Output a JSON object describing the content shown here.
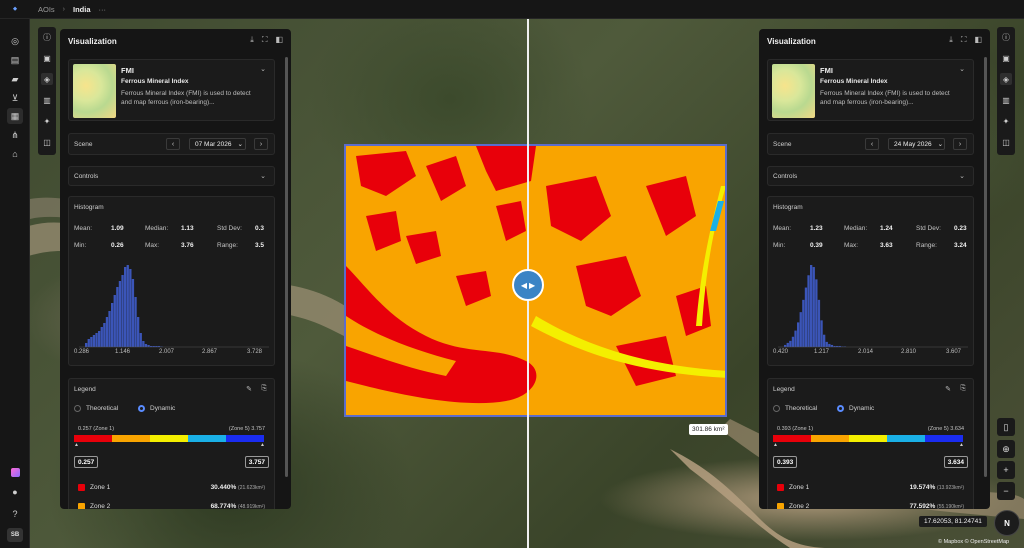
{
  "breadcrumb": {
    "root": "AOIs",
    "current": "India",
    "more": "···"
  },
  "user": {
    "initials": "SB"
  },
  "left_nav": [
    "explore-icon",
    "catalog-icon",
    "truck-icon",
    "cart-icon",
    "map-icon",
    "workflow-icon",
    "warehouse-icon"
  ],
  "map": {
    "area_label": "301.86 km²",
    "coords": "17.62053, 81.24741",
    "compass": "N",
    "attribution": "© Mapbox © OpenStreetMap",
    "zoom_in": "+",
    "zoom_out": "−"
  },
  "panels": {
    "left": {
      "title": "Visualization",
      "index_name": "FMI",
      "index_full": "Ferrous Mineral Index",
      "index_desc": "Ferrous Mineral Index (FMI) is used to detect and map ferrous (iron-bearing)...",
      "scene_label": "Scene",
      "scene_date": "07 Mar 2026",
      "controls_label": "Controls",
      "histogram_label": "Histogram",
      "stats": {
        "mean_label": "Mean:",
        "mean": "1.09",
        "median_label": "Median:",
        "median": "1.13",
        "std_label": "Std Dev:",
        "std": "0.3",
        "min_label": "Min:",
        "min": "0.26",
        "max_label": "Max:",
        "max": "3.76",
        "range_label": "Range:",
        "range": "3.5"
      },
      "hist_ticks": [
        "0.286",
        "1.146",
        "2.007",
        "2.867",
        "3.728"
      ],
      "hist_values": [
        4,
        8,
        10,
        12,
        14,
        16,
        20,
        24,
        30,
        36,
        44,
        52,
        60,
        66,
        72,
        80,
        82,
        78,
        68,
        50,
        30,
        14,
        6,
        3,
        2,
        1,
        1,
        1,
        1,
        0.5
      ],
      "legend_label": "Legend",
      "mode_theoretical": "Theoretical",
      "mode_dynamic": "Dynamic",
      "zone_min_label": "0.257 (Zone 1)",
      "zone_max_label": "(Zone 5) 3.757",
      "min_value": "0.257",
      "max_value": "3.757",
      "zones": [
        {
          "name": "Zone 1",
          "pct": "30.440%",
          "area": "(21.623km²)",
          "color": "#e8000a"
        },
        {
          "name": "Zone 2",
          "pct": "68.774%",
          "area": "(48.919km²)",
          "color": "#f9a400"
        }
      ]
    },
    "right": {
      "title": "Visualization",
      "index_name": "FMI",
      "index_full": "Ferrous Mineral Index",
      "index_desc": "Ferrous Mineral Index (FMI) is used to detect and map ferrous (iron-bearing)...",
      "scene_label": "Scene",
      "scene_date": "24 May 2026",
      "controls_label": "Controls",
      "histogram_label": "Histogram",
      "stats": {
        "mean_label": "Mean:",
        "mean": "1.23",
        "median_label": "Median:",
        "median": "1.24",
        "std_label": "Std Dev:",
        "std": "0.23",
        "min_label": "Min:",
        "min": "0.39",
        "max_label": "Max:",
        "max": "3.63",
        "range_label": "Range:",
        "range": "3.24"
      },
      "hist_ticks": [
        "0.420",
        "1.217",
        "2.014",
        "2.810",
        "3.607"
      ],
      "hist_values": [
        2,
        4,
        6,
        10,
        16,
        24,
        34,
        46,
        58,
        70,
        80,
        78,
        66,
        46,
        26,
        12,
        5,
        3,
        2,
        1,
        1,
        1,
        0.5,
        0.5
      ],
      "legend_label": "Legend",
      "mode_theoretical": "Theoretical",
      "mode_dynamic": "Dynamic",
      "zone_min_label": "0.393 (Zone 1)",
      "zone_max_label": "(Zone 5) 3.634",
      "min_value": "0.393",
      "max_value": "3.634",
      "zones": [
        {
          "name": "Zone 1",
          "pct": "19.574%",
          "area": "(13.923km²)",
          "color": "#e8000a"
        },
        {
          "name": "Zone 2",
          "pct": "77.592%",
          "area": "(55.190km²)",
          "color": "#f9a400"
        }
      ]
    }
  },
  "legend_colors": [
    "#e8000a",
    "#f9a400",
    "#f4ef00",
    "#1ab0e6",
    "#1a2cf0"
  ],
  "hist_color": "#3b55b8"
}
